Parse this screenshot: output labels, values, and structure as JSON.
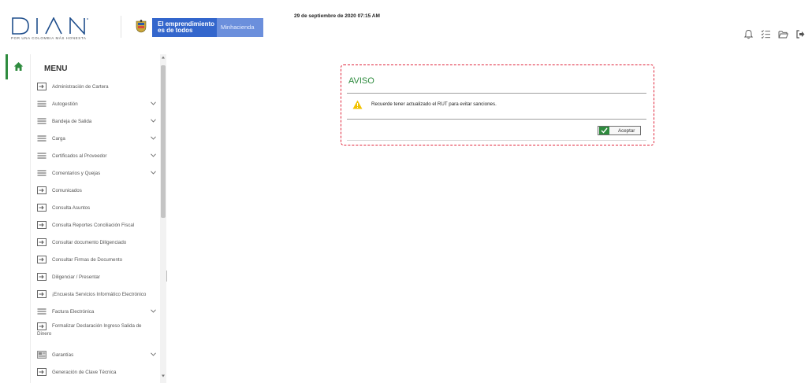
{
  "header": {
    "logo_text": "DIAN",
    "logo_tagline": "POR UNA COLOMBIA MÁS HONESTA",
    "banner_line1": "El emprendimiento",
    "banner_line2": "es de todos",
    "banner_ministry": "Minhacienda",
    "date": "29 de septiembre de 2020 07:15 AM",
    "icons": [
      "bell-icon",
      "checklist-icon",
      "folder-icon",
      "logout-icon"
    ]
  },
  "sidebar": {
    "menu_title": "MENU",
    "items": [
      {
        "label": "Administración de Cartera",
        "icon": "arrow-box-icon",
        "expandable": false
      },
      {
        "label": "Autogestión",
        "icon": "hamburger-icon",
        "expandable": true
      },
      {
        "label": "Bandeja de Salida",
        "icon": "hamburger-icon",
        "expandable": true
      },
      {
        "label": "Carga",
        "icon": "hamburger-icon",
        "expandable": true
      },
      {
        "label": "Certificados al Proveedor",
        "icon": "hamburger-icon",
        "expandable": true
      },
      {
        "label": "Comentarios y Quejas",
        "icon": "hamburger-icon",
        "expandable": true
      },
      {
        "label": "Comunicados",
        "icon": "arrow-box-icon",
        "expandable": false
      },
      {
        "label": "Consulta Asuntos",
        "icon": "arrow-box-icon",
        "expandable": false
      },
      {
        "label": "Consulta Reportes Conciliación Fiscal",
        "icon": "arrow-box-icon",
        "expandable": false
      },
      {
        "label": "Consultar documento Diligenciado",
        "icon": "arrow-box-icon",
        "expandable": false
      },
      {
        "label": "Consultar Firmas de Documento",
        "icon": "arrow-box-icon",
        "expandable": false
      },
      {
        "label": "Diligenciar / Presentar",
        "icon": "arrow-box-icon",
        "expandable": false
      },
      {
        "label": "¡Encuesta Servicios Informático Electrónico",
        "icon": "arrow-box-icon",
        "expandable": false
      },
      {
        "label": "Factura Electrónica",
        "icon": "hamburger-icon",
        "expandable": true
      },
      {
        "label": "Formalizar Declaración Ingreso Salida de",
        "label2": "Dinero",
        "icon": "arrow-box-icon",
        "expandable": false
      },
      {
        "label": "Garantías",
        "icon": "guarantee-icon",
        "expandable": true
      },
      {
        "label": "Generación de Clave Técnica",
        "icon": "arrow-box-icon",
        "expandable": false
      },
      {
        "label": "",
        "icon": "hamburger-icon",
        "expandable": false
      }
    ]
  },
  "modal": {
    "title": "AVISO",
    "message": "Recuerde tener actualizado el RUT para evitar sanciones.",
    "accept_label": "Aceptar"
  },
  "colors": {
    "brand_green": "#2e8b3e",
    "banner_blue": "#3366cc",
    "banner_light_blue": "#6b8fdc",
    "dian_blue": "#1f4e8c",
    "highlight_red": "#e0243a",
    "warning_yellow": "#f2c200"
  }
}
